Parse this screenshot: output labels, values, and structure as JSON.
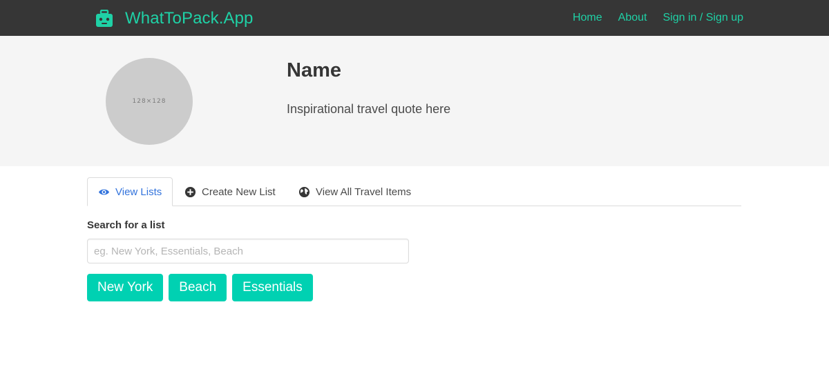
{
  "navbar": {
    "brand_icon": "suitcase-icon",
    "brand_title": "WhatToPack.App",
    "links": [
      {
        "label": "Home"
      },
      {
        "label": "About"
      },
      {
        "label": "Sign in / Sign up"
      }
    ],
    "accent_color": "#1fd1a6",
    "background_color": "#363636"
  },
  "hero": {
    "avatar_placeholder": "128×128",
    "name": "Name",
    "quote": "Inspirational travel quote here"
  },
  "tabs": [
    {
      "label": "View Lists",
      "icon": "eye-icon",
      "active": true
    },
    {
      "label": "Create New List",
      "icon": "plus-circle-icon",
      "active": false
    },
    {
      "label": "View All Travel Items",
      "icon": "globe-icon",
      "active": false
    }
  ],
  "search": {
    "label": "Search for a list",
    "placeholder": "eg. New York, Essentials, Beach",
    "value": ""
  },
  "quick_lists": [
    {
      "label": "New York"
    },
    {
      "label": "Beach"
    },
    {
      "label": "Essentials"
    }
  ],
  "colors": {
    "primary_button": "#00d1b2",
    "active_tab": "#3273dc"
  }
}
